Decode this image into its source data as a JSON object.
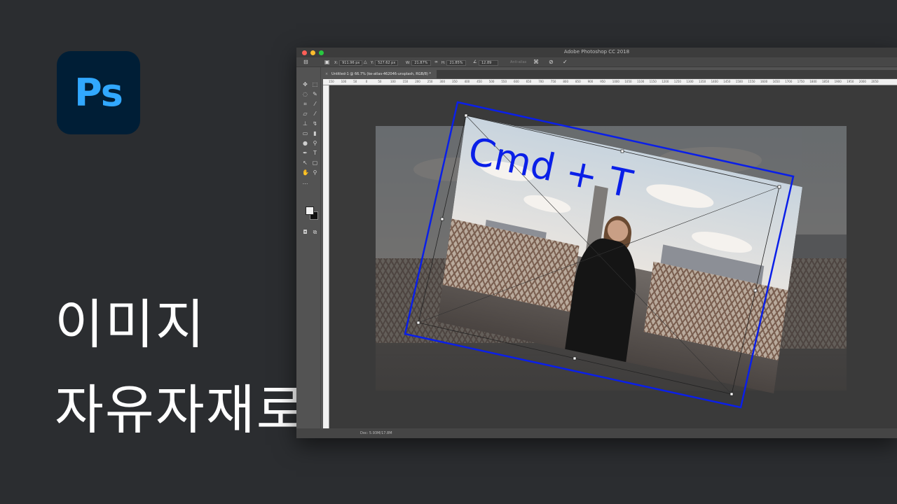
{
  "app": {
    "logo_text": "Ps",
    "logo_bg": "#001e36",
    "logo_fg": "#31a8ff",
    "window_title": "Adobe Photoshop CC 2018"
  },
  "headline": {
    "line1": "이미지",
    "line2": "자유자재로"
  },
  "options_bar": {
    "x_label": "X:",
    "x_value": "911.96 px",
    "y_label": "Y:",
    "y_value": "527.62 px",
    "w_label": "W:",
    "w_value": "21.87%",
    "h_label": "H:",
    "h_value": "21.85%",
    "angle_value": "12.89",
    "antialias_label": "Anti-alias",
    "cancel_icon": "cancel-icon",
    "commit_icon": "checkmark-icon"
  },
  "document_tab": {
    "label": "Untitled-1 @ 66.7% (ke-atlas-462046-unsplash, RGB/8) *"
  },
  "ruler_ticks": [
    "150",
    "100",
    "50",
    "0",
    "50",
    "100",
    "150",
    "200",
    "250",
    "300",
    "350",
    "400",
    "450",
    "500",
    "550",
    "600",
    "650",
    "700",
    "750",
    "800",
    "850",
    "900",
    "950",
    "1000",
    "1050",
    "1100",
    "1150",
    "1200",
    "1250",
    "1300",
    "1350",
    "1400",
    "1450",
    "1500",
    "1550",
    "1600",
    "1650",
    "1700",
    "1750",
    "1800",
    "1850",
    "1900",
    "1950",
    "2000",
    "2050"
  ],
  "status": {
    "doc_info": "Doc: 5.93M/17.8M"
  },
  "annotation": {
    "shortcut_text": "Cmd + T",
    "color": "#0a1fe8"
  },
  "tools": [
    "move-icon",
    "marquee-icon",
    "lasso-icon",
    "quick-select-icon",
    "crop-icon",
    "eyedropper-icon",
    "healing-icon",
    "brush-icon",
    "stamp-icon",
    "history-brush-icon",
    "eraser-icon",
    "gradient-icon",
    "blur-icon",
    "dodge-icon",
    "pen-icon",
    "type-icon",
    "path-select-icon",
    "shape-icon",
    "hand-icon",
    "zoom-icon",
    "more-tools-icon"
  ]
}
